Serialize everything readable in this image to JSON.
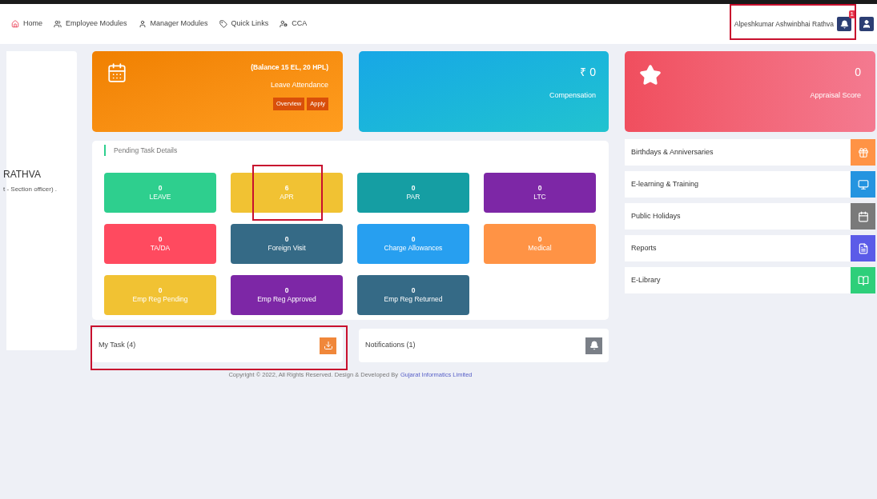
{
  "nav": {
    "items": [
      {
        "label": "Home",
        "kind": "home"
      },
      {
        "label": "Employee Modules",
        "kind": "users"
      },
      {
        "label": "Manager Modules",
        "kind": "user"
      },
      {
        "label": "Quick Links",
        "kind": "tag"
      },
      {
        "label": "CCA",
        "kind": "usercog"
      }
    ],
    "user_name": "Alpeshkumar Ashwinbhai Rathva",
    "user_highlighted": true,
    "notification_badge": "1"
  },
  "profile": {
    "name": "RATHVA",
    "designation": "t - Section officer) ."
  },
  "leave_card": {
    "balance": "(Balance 15 EL, 20 HPL)",
    "title": "Leave Attendance",
    "buttons": [
      "Overview",
      "Apply"
    ]
  },
  "compensation_card": {
    "value": "₹ 0",
    "title": "Compensation"
  },
  "appraisal_card": {
    "value": "0",
    "title": "Appraisal Score"
  },
  "pending_tasks": {
    "title": "Pending Task Details",
    "tiles": [
      {
        "count": "0",
        "label": "LEAVE",
        "color": "#2ecf8e",
        "highlighted": false
      },
      {
        "count": "6",
        "label": "APR",
        "color": "#f1c233",
        "highlighted": true
      },
      {
        "count": "0",
        "label": "PAR",
        "color": "#159ea3",
        "highlighted": false
      },
      {
        "count": "0",
        "label": "LTC",
        "color": "#7d27a6",
        "highlighted": false
      },
      {
        "count": "0",
        "label": "TA/DA",
        "color": "#ff4a5f",
        "highlighted": false
      },
      {
        "count": "0",
        "label": "Foreign Visit",
        "color": "#356a86",
        "highlighted": false
      },
      {
        "count": "0",
        "label": "Charge Allowances",
        "color": "#279ff0",
        "highlighted": false
      },
      {
        "count": "0",
        "label": "Medical",
        "color": "#ff9345",
        "highlighted": false
      },
      {
        "count": "0",
        "label": "Emp Reg Pending",
        "color": "#f1c233",
        "highlighted": false
      },
      {
        "count": "0",
        "label": "Emp Reg Approved",
        "color": "#7d27a6",
        "highlighted": false
      },
      {
        "count": "0",
        "label": "Emp Reg Returned",
        "color": "#356a86",
        "highlighted": false
      }
    ]
  },
  "my_task": {
    "label": "My Task (4)",
    "highlighted": true
  },
  "notifications": {
    "label": "Notifications (1)"
  },
  "side_links": [
    {
      "label": "Birthdays & Anniversaries",
      "kind": "gift",
      "color": "#ff9345"
    },
    {
      "label": "E-learning & Training",
      "kind": "monitor",
      "color": "#2494e0"
    },
    {
      "label": "Public Holidays",
      "kind": "calendar",
      "color": "#7a7a7a"
    },
    {
      "label": "Reports",
      "kind": "file",
      "color": "#5b5be8"
    },
    {
      "label": "E-Library",
      "kind": "book",
      "color": "#2ecf7a"
    }
  ],
  "footer": {
    "text": "Copyright © 2022, All Rights Reserved. Design & Developed By",
    "link": "Gujarat Informatics Limited"
  }
}
